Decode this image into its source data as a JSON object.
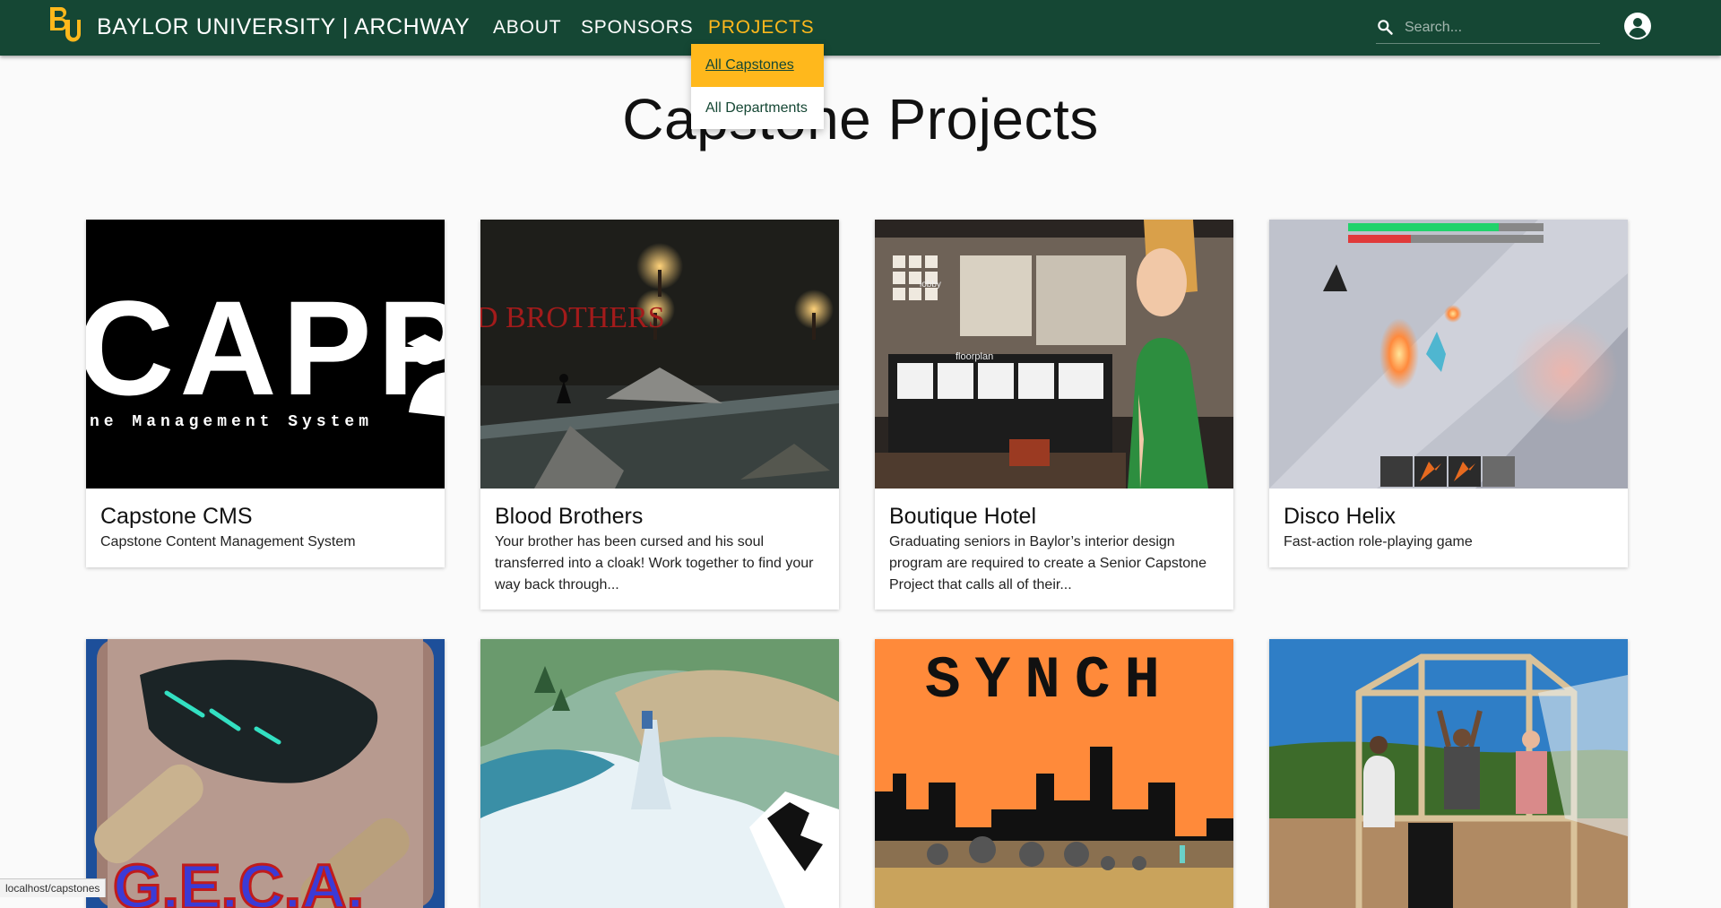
{
  "header": {
    "brand": "BAYLOR UNIVERSITY | ARCHWAY",
    "nav": {
      "about": "ABOUT",
      "sponsors": "SPONSORS",
      "projects": "PROJECTS"
    },
    "search_placeholder": "Search...",
    "logo_icon": "baylor-bu-logo",
    "account_icon": "account-circle-icon",
    "search_icon": "search-icon"
  },
  "dropdown": {
    "items": [
      "All Capstones",
      "All Departments"
    ],
    "active": "All Capstones"
  },
  "page": {
    "title": "Capstone Projects"
  },
  "cards": [
    {
      "title": "Capstone CMS",
      "desc": "Capstone Content Management System",
      "image_text": "CAPPY",
      "image_subtext": "ne Management System"
    },
    {
      "title": "Blood Brothers",
      "desc": "Your brother has been cursed and his soul transferred into a cloak! Work together to find your way back through...",
      "image_text": "D BROTHERS"
    },
    {
      "title": "Boutique Hotel",
      "desc": "Graduating seniors in Baylor’s interior design program are required to create a Senior Capstone Project that calls all of their...",
      "image_text": "floorplan",
      "image_text2": "lobby"
    },
    {
      "title": "Disco Helix",
      "desc": "Fast-action role-playing game"
    },
    {
      "title": "",
      "desc": "",
      "image_text": "G.E.C.A."
    },
    {
      "title": "",
      "desc": ""
    },
    {
      "title": "",
      "desc": "",
      "image_text": "SYNCH"
    },
    {
      "title": "",
      "desc": ""
    }
  ],
  "status_bar": {
    "url": "localhost/capstones"
  },
  "colors": {
    "header_bg": "#154734",
    "accent_gold": "#ffb81c",
    "page_bg": "#fafafa"
  }
}
